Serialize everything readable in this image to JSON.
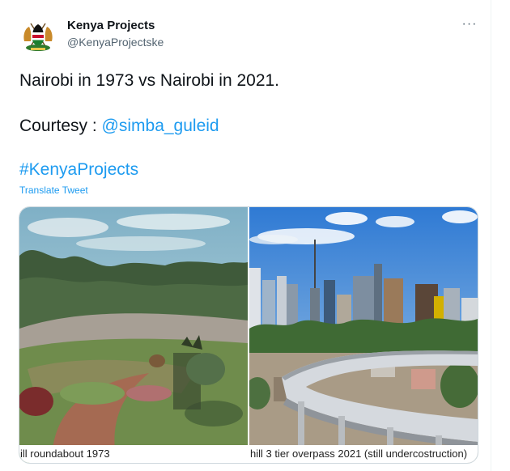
{
  "account": {
    "display_name": "Kenya Projects",
    "handle": "@KenyaProjectske",
    "avatar_icon": "kenya-coat-of-arms-icon"
  },
  "menu": {
    "more_label": "···"
  },
  "tweet": {
    "line1": "Nairobi in 1973 vs Nairobi in 2021.",
    "courtesy_prefix": "Courtesy : ",
    "mention": "@simba_guleid",
    "hashtag": "#KenyaProjects",
    "translate_label": "Translate Tweet"
  },
  "media": {
    "left_caption": "ill roundabout 1973",
    "right_caption": "hill 3 tier overpass 2021 (still undercostruction)"
  },
  "colors": {
    "link": "#1d9bf0",
    "text": "#0f1419",
    "secondary": "#536471"
  }
}
